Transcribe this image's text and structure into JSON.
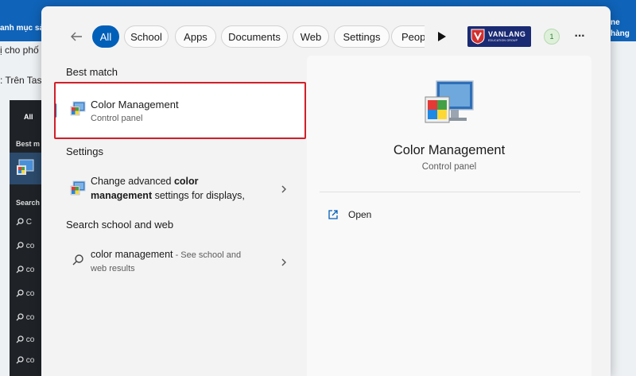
{
  "background": {
    "top_left_text": "anh mục sả",
    "top_right_text": "ne hàng",
    "line1": "ị cho phố",
    "line2": ": Trên Tas",
    "dark_panel": {
      "all_label": "All",
      "best_match_label": "Best m",
      "search_label": "Search",
      "items": [
        "C",
        "co",
        "co",
        "co",
        "co",
        "co",
        "co"
      ]
    }
  },
  "search": {
    "filters": [
      {
        "label": "All",
        "active": true
      },
      {
        "label": "School",
        "active": false
      },
      {
        "label": "Apps",
        "active": false
      },
      {
        "label": "Documents",
        "active": false
      },
      {
        "label": "Web",
        "active": false
      },
      {
        "label": "Settings",
        "active": false
      },
      {
        "label": "Peop",
        "active": false
      }
    ],
    "org": {
      "name": "VANLANG",
      "subtitle": "EDUCATION GROUP"
    },
    "avatar_text": "1",
    "more_label": "···"
  },
  "results": {
    "best_match_heading": "Best match",
    "best_match": {
      "title": "Color Management",
      "subtitle": "Control panel"
    },
    "settings_heading": "Settings",
    "settings_item": {
      "line1_pre": "Change advanced ",
      "line1_bold": "color",
      "line2_bold": "management",
      "line2_post": " settings for displays,"
    },
    "web_heading": "Search school and web",
    "web_item": {
      "query": "color management",
      "suffix": " - See school and",
      "line2": "web results"
    }
  },
  "preview": {
    "title": "Color Management",
    "subtitle": "Control panel",
    "actions": [
      {
        "label": "Open",
        "icon": "open-external-icon"
      }
    ]
  },
  "colors": {
    "accent": "#005fb8",
    "highlight_border": "#d0202a",
    "background_blue": "#0f63b8"
  }
}
